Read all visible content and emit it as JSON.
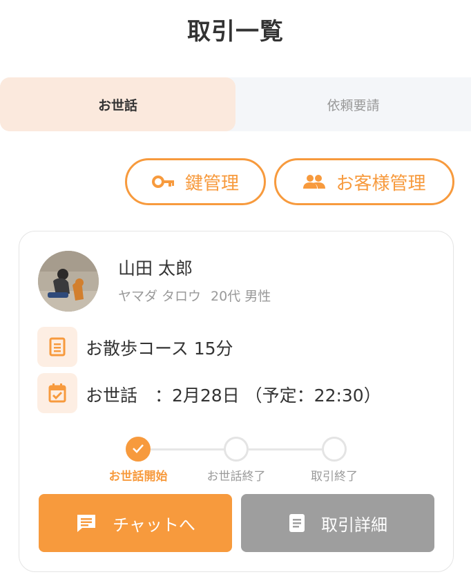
{
  "header": {
    "title": "取引一覧"
  },
  "tabs": [
    {
      "label": "お世話",
      "active": true
    },
    {
      "label": "依頼要請",
      "active": false
    }
  ],
  "actions": {
    "key_label": "鍵管理",
    "customer_label": "お客様管理"
  },
  "card": {
    "user": {
      "name": "山田 太郎",
      "kana": "ヤマダ タロウ",
      "profile": "20代 男性"
    },
    "course": "お散歩コース 15分",
    "schedule": "お世話　：2月28日 （予定：22:30）",
    "progress": {
      "steps": [
        {
          "label": "お世話開始",
          "done": true
        },
        {
          "label": "お世話終了",
          "done": false
        },
        {
          "label": "取引終了",
          "done": false
        }
      ]
    },
    "buttons": {
      "chat_label": "チャットへ",
      "detail_label": "取引詳細"
    }
  },
  "icons": {
    "key": "key-icon",
    "customers": "people-icon",
    "course": "document-icon",
    "schedule": "calendar-check-icon",
    "step_done": "check-icon",
    "chat": "chat-bubble-icon",
    "detail": "document-icon"
  },
  "colors": {
    "accent": "#f79a3d",
    "accent_soft": "#fbe9dd",
    "tab_bg": "#f4f6f9",
    "disabled_button": "#9e9e9e",
    "muted_text": "#999999"
  }
}
